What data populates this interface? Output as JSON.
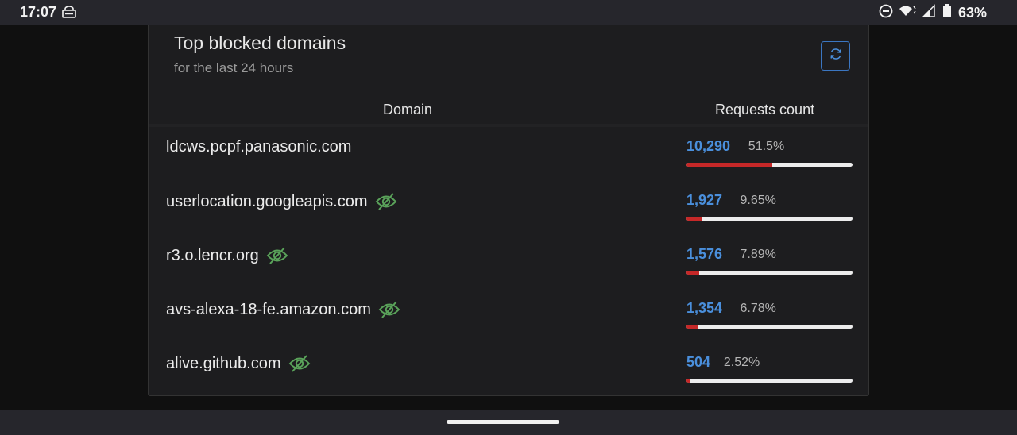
{
  "status_bar": {
    "time": "17:07",
    "battery_percent": "63%",
    "icons": [
      "vpn-key-icon",
      "do-not-disturb-icon",
      "wifi-icon",
      "signal-icon",
      "battery-icon"
    ]
  },
  "card": {
    "title": "Top blocked domains",
    "subtitle": "for the last 24 hours",
    "refresh_icon": "refresh-icon",
    "columns": [
      "Domain",
      "Requests count"
    ],
    "rows": [
      {
        "domain": "ldcws.pcpf.panasonic.com",
        "count": "10,290",
        "percent": "51.5%",
        "fraction": 0.515,
        "hidden_icon": false
      },
      {
        "domain": "userlocation.googleapis.com",
        "count": "1,927",
        "percent": "9.65%",
        "fraction": 0.0965,
        "hidden_icon": true
      },
      {
        "domain": "r3.o.lencr.org",
        "count": "1,576",
        "percent": "7.89%",
        "fraction": 0.0789,
        "hidden_icon": true
      },
      {
        "domain": "avs-alexa-18-fe.amazon.com",
        "count": "1,354",
        "percent": "6.78%",
        "fraction": 0.0678,
        "hidden_icon": true
      },
      {
        "domain": "alive.github.com",
        "count": "504",
        "percent": "2.52%",
        "fraction": 0.0252,
        "hidden_icon": true
      }
    ]
  },
  "colors": {
    "accent_blue": "#4a8fdc",
    "bar_fill_red": "#c62828",
    "eye_off_green": "#5aa35a"
  }
}
